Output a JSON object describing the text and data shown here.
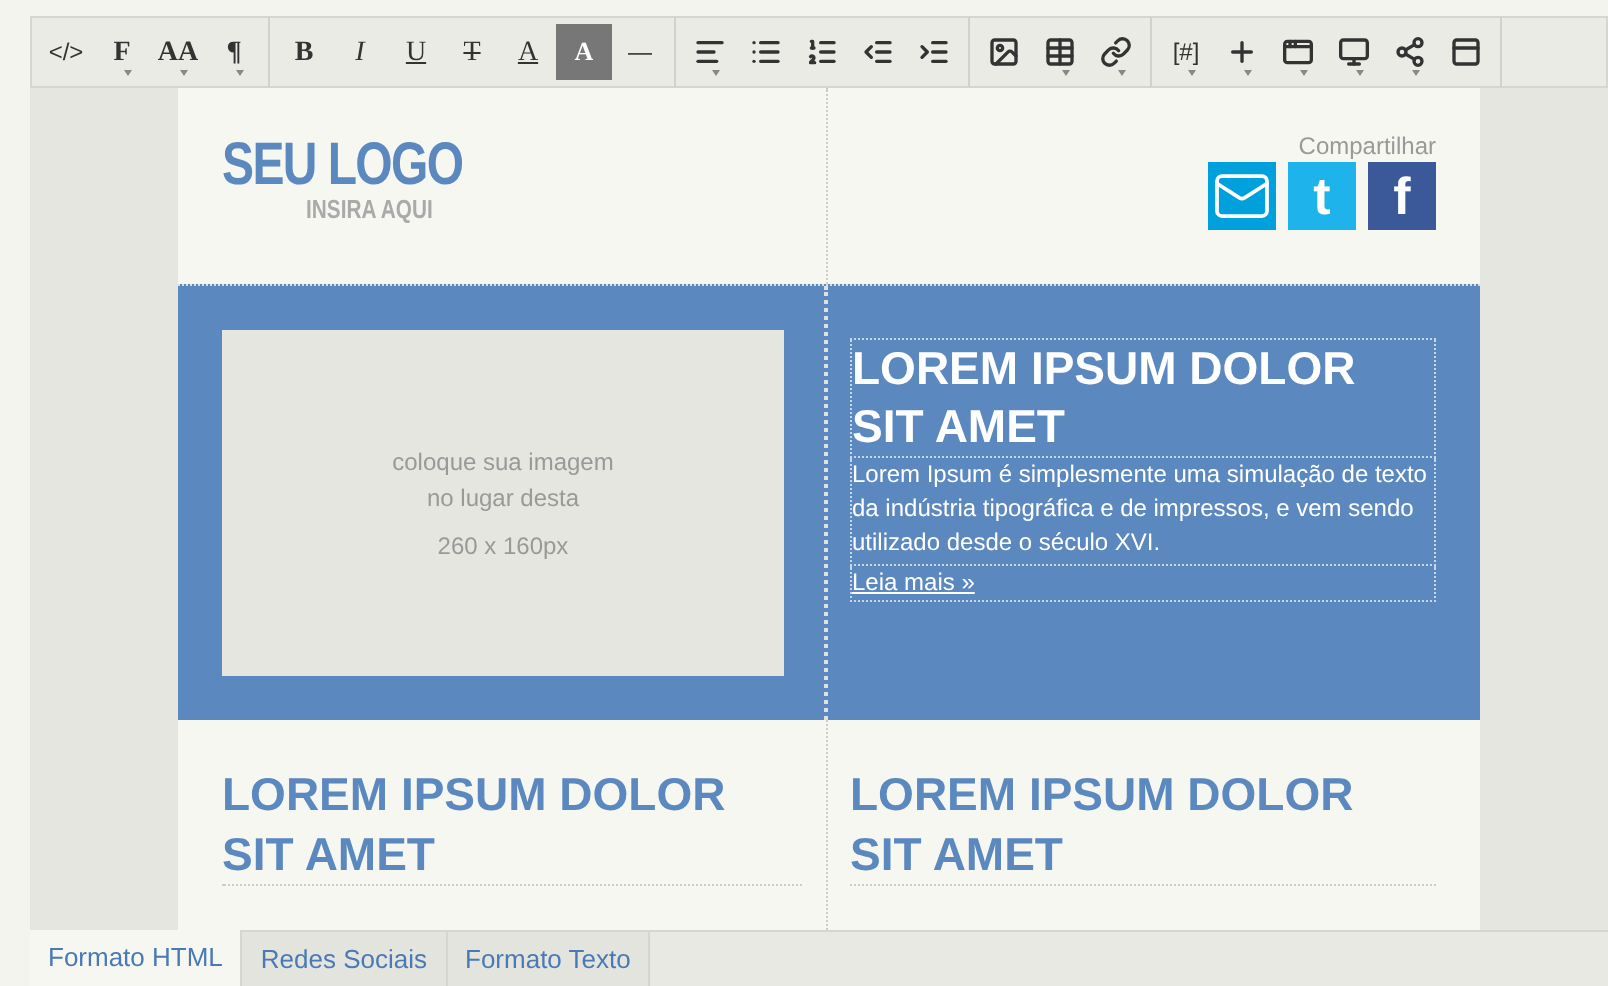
{
  "toolbar": [
    [
      {
        "kind": "text",
        "label": "</>",
        "menu": false
      },
      {
        "kind": "serif",
        "label": "F",
        "menu": true
      },
      {
        "kind": "serif",
        "label": "AA",
        "menu": true
      },
      {
        "kind": "serif",
        "label": "¶",
        "menu": true
      }
    ],
    [
      {
        "kind": "bold",
        "label": "B",
        "menu": false
      },
      {
        "kind": "italic",
        "label": "I",
        "menu": false
      },
      {
        "kind": "underline",
        "label": "U",
        "menu": false
      },
      {
        "kind": "strike",
        "label": "T",
        "menu": false
      },
      {
        "kind": "underline",
        "label": "A",
        "menu": false
      },
      {
        "kind": "highlight",
        "label": "A",
        "menu": false
      },
      {
        "kind": "text",
        "label": "—",
        "menu": false
      }
    ],
    [
      {
        "kind": "icon",
        "menu": true
      },
      {
        "kind": "icon",
        "menu": false
      },
      {
        "kind": "icon",
        "menu": false
      },
      {
        "kind": "icon",
        "menu": false
      },
      {
        "kind": "icon",
        "menu": false
      }
    ],
    [
      {
        "kind": "icon",
        "menu": false
      },
      {
        "kind": "icon",
        "menu": true
      },
      {
        "kind": "icon",
        "menu": true
      }
    ],
    [
      {
        "kind": "text",
        "label": "[#]",
        "menu": true
      },
      {
        "kind": "icon",
        "menu": true
      },
      {
        "kind": "icon",
        "menu": true
      },
      {
        "kind": "icon",
        "menu": true
      },
      {
        "kind": "icon",
        "menu": true
      },
      {
        "kind": "icon",
        "menu": false
      }
    ]
  ],
  "header": {
    "logo": "SEU LOGO",
    "logo_sub": "INSIRA AQUI",
    "share_label": "Compartilhar",
    "share_buttons": [
      {
        "kind": "mail"
      },
      {
        "kind": "letter",
        "label": "t"
      },
      {
        "kind": "letter",
        "label": "f"
      }
    ]
  },
  "feature": {
    "image_hint": "coloque sua imagem",
    "image_hint_2": "no lugar desta",
    "image_size": "260 x 160px",
    "title": "LOREM IPSUM DOLOR SIT AMET",
    "body": "Lorem Ipsum é simplesmente uma simulação de texto da indústria tipográfica e de impressos, e vem sendo utilizado desde o século XVI.",
    "link": "Leia mais »"
  },
  "columns": [
    {
      "title": "LOREM IPSUM DOLOR SIT AMET"
    },
    {
      "title": "LOREM IPSUM DOLOR SIT AMET"
    }
  ],
  "tabs": [
    {
      "label": "Formato HTML",
      "selected": true
    },
    {
      "label": "Redes Sociais",
      "selected": false
    },
    {
      "label": "Formato Texto",
      "selected": false
    }
  ]
}
